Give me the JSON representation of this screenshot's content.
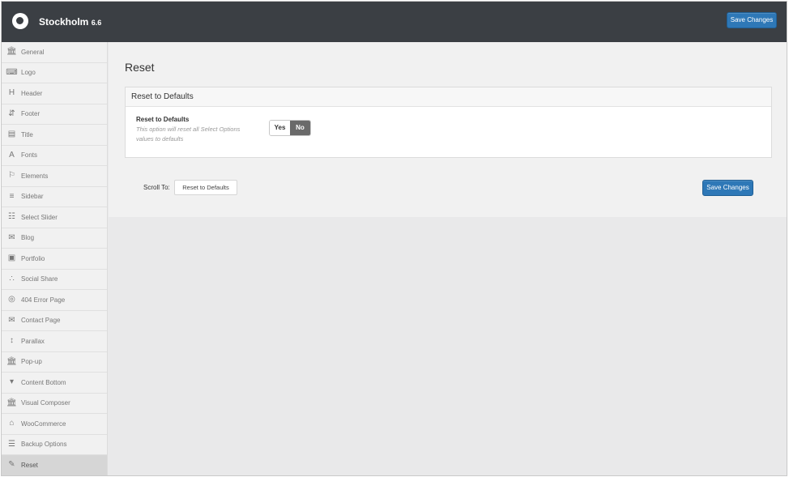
{
  "app": {
    "name": "Stockholm",
    "version": "6.6"
  },
  "header": {
    "save_label": "Save Changes"
  },
  "sidebar": {
    "items": [
      {
        "label": "General",
        "icon": "bank-icon"
      },
      {
        "label": "Logo",
        "icon": "keyboard-icon"
      },
      {
        "label": "Header",
        "icon": "header-icon"
      },
      {
        "label": "Footer",
        "icon": "sort-icon"
      },
      {
        "label": "Title",
        "icon": "title-card-icon"
      },
      {
        "label": "Fonts",
        "icon": "font-icon"
      },
      {
        "label": "Elements",
        "icon": "flag-icon"
      },
      {
        "label": "Sidebar",
        "icon": "menu-lines-icon"
      },
      {
        "label": "Select Slider",
        "icon": "sliders-icon"
      },
      {
        "label": "Blog",
        "icon": "chat-icon"
      },
      {
        "label": "Portfolio",
        "icon": "image-icon"
      },
      {
        "label": "Social Share",
        "icon": "share-icon"
      },
      {
        "label": "404 Error Page",
        "icon": "target-icon"
      },
      {
        "label": "Contact Page",
        "icon": "envelope-icon"
      },
      {
        "label": "Parallax",
        "icon": "vertical-arrows-icon"
      },
      {
        "label": "Pop-up",
        "icon": "bank-icon"
      },
      {
        "label": "Content Bottom",
        "icon": "caret-box-icon"
      },
      {
        "label": "Visual Composer",
        "icon": "bank-icon"
      },
      {
        "label": "WooCommerce",
        "icon": "cart-icon"
      },
      {
        "label": "Backup Options",
        "icon": "database-icon"
      },
      {
        "label": "Reset",
        "icon": "eraser-icon"
      }
    ],
    "active": "Reset"
  },
  "main": {
    "title": "Reset",
    "section": {
      "title": "Reset to Defaults",
      "option_label": "Reset to Defaults",
      "option_desc": "This option will reset all Select Options values to defaults",
      "toggle": {
        "yes": "Yes",
        "no": "No",
        "selected": "No"
      }
    },
    "scroll_to_label": "Scroll To:",
    "scroll_to_value": "Reset to Defaults",
    "save_label": "Save Changes"
  },
  "colors": {
    "topbar": "#3b3f44",
    "accent": "#2e78b7",
    "toggle_active": "#6a6a6a"
  }
}
